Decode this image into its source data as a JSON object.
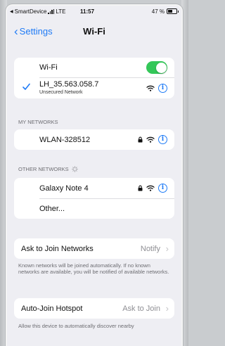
{
  "status_bar": {
    "carrier": "SmartDevice",
    "network": "LTE",
    "time": "11:57",
    "battery": "47 %"
  },
  "nav": {
    "back_label": "Settings",
    "title": "Wi-Fi"
  },
  "wifi": {
    "toggle_label": "Wi-Fi",
    "toggle_on": true,
    "connected_name": "LH_35.563.058.7",
    "connected_subtitle": "Unsecured Network"
  },
  "my_networks": {
    "header": "MY NETWORKS",
    "items": [
      {
        "name": "WLAN-328512",
        "locked": true
      }
    ]
  },
  "other_networks": {
    "header": "OTHER NETWORKS",
    "items": [
      {
        "name": "Galaxy Note 4",
        "locked": true
      },
      {
        "name": "Other..."
      }
    ]
  },
  "ask_to_join": {
    "label": "Ask to Join Networks",
    "value": "Notify",
    "footer": "Known networks will be joined automatically. If no known networks are available, you will be notified of available networks."
  },
  "auto_join": {
    "label": "Auto-Join Hotspot",
    "value": "Ask to Join",
    "footer": "Allow this device to automatically discover nearby"
  },
  "colors": {
    "accent": "#1f7bf6",
    "toggle_on": "#34c759",
    "background": "#eeeef3"
  }
}
